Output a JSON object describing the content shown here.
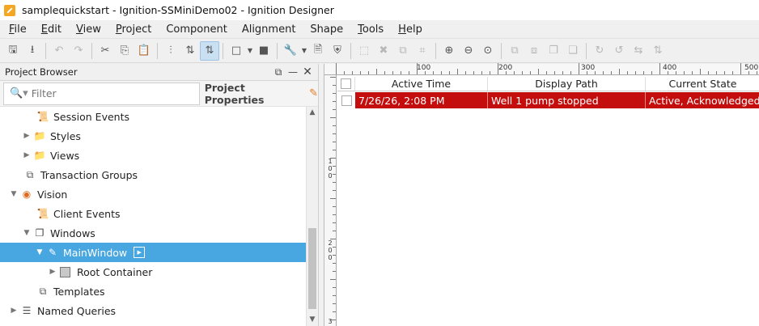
{
  "window": {
    "title": "samplequickstart - Ignition-SSMiniDemo02 - Ignition Designer",
    "app_icon": "ignition-app-icon"
  },
  "menu": [
    {
      "label": "File",
      "mnemonic": "F",
      "rest": "ile"
    },
    {
      "label": "Edit",
      "mnemonic": "E",
      "rest": "dit"
    },
    {
      "label": "View",
      "mnemonic": "V",
      "rest": "iew"
    },
    {
      "label": "Project",
      "mnemonic": "P",
      "rest": "roject"
    },
    {
      "label": "Component",
      "mnemonic": "",
      "rest": "Component"
    },
    {
      "label": "Alignment",
      "mnemonic": "",
      "rest": "Alignment"
    },
    {
      "label": "Shape",
      "mnemonic": "",
      "rest": "Shape"
    },
    {
      "label": "Tools",
      "mnemonic": "T",
      "rest": "ools"
    },
    {
      "label": "Help",
      "mnemonic": "H",
      "rest": "elp"
    }
  ],
  "project_browser": {
    "title": "Project Browser",
    "search_placeholder": "Filter",
    "project_properties": "Project Properties",
    "tree": [
      {
        "label": "Session Events",
        "icon": "script-icon",
        "indent": 1,
        "expandable": false
      },
      {
        "label": "Styles",
        "icon": "folder-icon",
        "indent": 1,
        "expandable": true,
        "expanded": false
      },
      {
        "label": "Views",
        "icon": "folder-icon",
        "indent": 1,
        "expandable": true,
        "expanded": false
      },
      {
        "label": "Transaction Groups",
        "icon": "transaction-groups-icon",
        "indent": 0,
        "expandable": false
      },
      {
        "label": "Vision",
        "icon": "vision-eye-icon",
        "indent": 0,
        "expandable": true,
        "expanded": true
      },
      {
        "label": "Client Events",
        "icon": "script-icon",
        "indent": 1,
        "expandable": false
      },
      {
        "label": "Windows",
        "icon": "windows-icon",
        "indent": 1,
        "expandable": true,
        "expanded": true
      },
      {
        "label": "MainWindow",
        "icon": "main-window-icon",
        "indent": 2,
        "expandable": true,
        "expanded": true,
        "selected": true
      },
      {
        "label": "Root Container",
        "icon": "root-container-icon",
        "indent": 3,
        "expandable": true,
        "expanded": false
      },
      {
        "label": "Templates",
        "icon": "templates-icon",
        "indent": 1,
        "expandable": false
      },
      {
        "label": "Named Queries",
        "icon": "named-queries-icon",
        "indent": 0,
        "expandable": true,
        "expanded": false
      }
    ]
  },
  "rulers": {
    "top_labels": [
      "100",
      "200",
      "300",
      "400",
      "500"
    ],
    "left_labels": [
      "100",
      "200",
      "3"
    ]
  },
  "alarm_table": {
    "columns": [
      "Active Time",
      "Display Path",
      "Current State"
    ],
    "rows": [
      {
        "active_time": "7/26/26, 2:08 PM",
        "display_path": "Well 1 pump stopped",
        "current_state": "Active, Acknowledged",
        "row_color": "#c40e0e"
      }
    ]
  },
  "colors": {
    "selection": "#48a6e0",
    "alarm_row": "#c40e0e"
  }
}
